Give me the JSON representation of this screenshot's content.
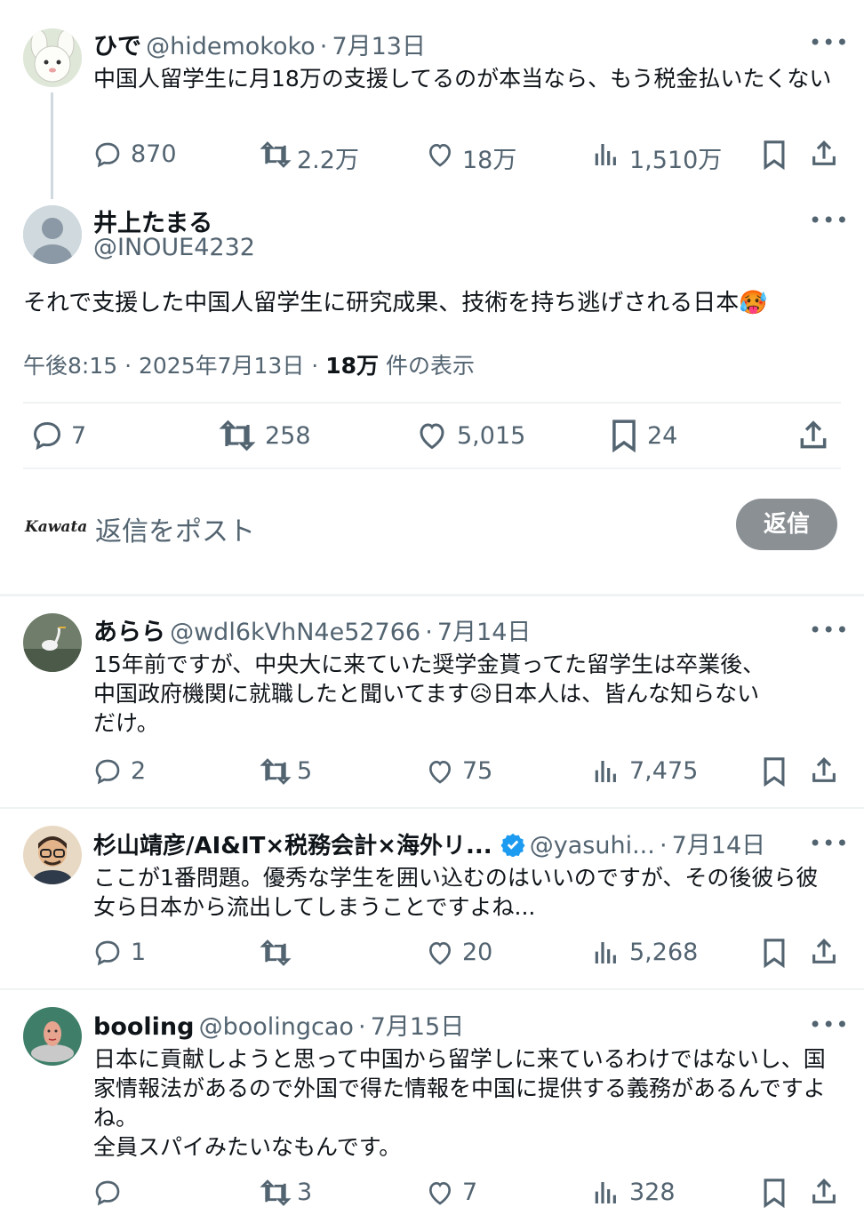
{
  "parent_tweet": {
    "name": "ひで",
    "handle": "@hidemokoko",
    "date": "7月13日",
    "text": "中国人留学生に月18万の支援してるのが本当なら、もう税金払いたくない",
    "replies": "870",
    "retweets": "2.2万",
    "likes": "18万",
    "views": "1,510万"
  },
  "main_tweet": {
    "name": "井上たまる",
    "handle": "@INOUE4232",
    "text": "それで支援した中国人留学生に研究成果、技術を持ち逃げされる日本",
    "emoji": "🥵",
    "time": "午後8:15",
    "date": "2025年7月13日",
    "views_count": "18万",
    "views_label": "件の表示",
    "replies": "7",
    "retweets": "258",
    "likes": "5,015",
    "bookmarks": "24"
  },
  "composer": {
    "logo_text": "Kawata",
    "placeholder": "返信をポスト",
    "button": "返信"
  },
  "replies": [
    {
      "name": "あらら",
      "handle": "@wdl6kVhN4e52766",
      "date": "7月14日",
      "text_1": "15年前ですが、中央大に来ていた奨学金貰ってた留学生は卒業後、",
      "text_2": "中国政府機関に就職したと聞いてます",
      "emoji": "😥",
      "text_3": "日本人は、皆んな知らない",
      "text_4": "だけ。",
      "replies": "2",
      "retweets": "5",
      "likes": "75",
      "views": "7,475"
    },
    {
      "name": "杉山靖彦/AI&IT×税務会計×海外リ...",
      "handle": "@yasuhi...",
      "date": "7月14日",
      "text": "ここが1番問題。優秀な学生を囲い込むのはいいのですが、その後彼ら彼女ら日本から流出してしまうことですよね...",
      "replies": "1",
      "retweets": "",
      "likes": "20",
      "views": "5,268"
    },
    {
      "name": "booling",
      "handle": "@boolingcao",
      "date": "7月15日",
      "text_1": "日本に貢献しようと思って中国から留学しに来ているわけではないし、国家情報法があるので外国で得た情報を中国に提供する義務があるんですよね。",
      "text_2": "全員スパイみたいなもんです。",
      "replies": "",
      "retweets": "3",
      "likes": "7",
      "views": "328"
    }
  ],
  "colors": {
    "text": "#0f1419",
    "secondary": "#536471",
    "divider": "#eff3f4",
    "verified": "#1d9bf0",
    "reply_button": "#8b9094"
  },
  "icons": [
    "reply-icon",
    "retweet-icon",
    "like-icon",
    "views-icon",
    "bookmark-icon",
    "share-icon",
    "more-icon",
    "verified-badge-icon"
  ]
}
